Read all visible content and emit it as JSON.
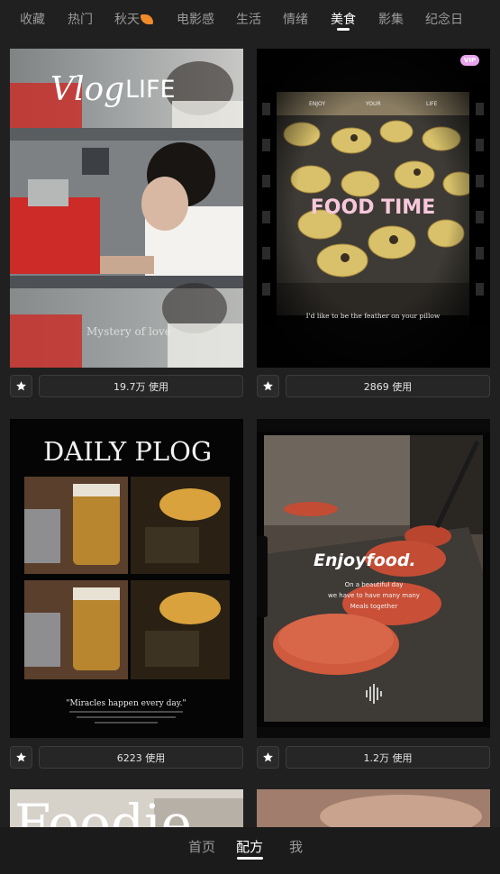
{
  "tabs": [
    {
      "label": "收藏"
    },
    {
      "label": "热门"
    },
    {
      "label": "秋天"
    },
    {
      "label": "电影感"
    },
    {
      "label": "生活"
    },
    {
      "label": "情绪"
    },
    {
      "label": "美食",
      "active": true
    },
    {
      "label": "影集"
    },
    {
      "label": "纪念日"
    }
  ],
  "cards": [
    {
      "usage": "19.7万 使用",
      "overlay": {
        "brand_script": "Vlog",
        "brand": "LIFE",
        "subtitle": "Mystery of love"
      }
    },
    {
      "vip": "VIP",
      "usage": "2869 使用",
      "overlay": {
        "film_labels": [
          "ENJOY",
          "YOUR",
          "LIFE"
        ],
        "title": "FOOD TIME",
        "caption": "I'd like to be the feather on your pillow"
      }
    },
    {
      "usage": "6223 使用",
      "overlay": {
        "title": "DAILY PLOG",
        "quote": "\"Miracles happen every day.\""
      }
    },
    {
      "usage": "1.2万 使用",
      "overlay": {
        "title": "Enjoyfood.",
        "line1": "On a beautiful day",
        "line2": "we have to have many many",
        "line3": "Meals together"
      }
    }
  ],
  "partial_cards": [
    {
      "overlay": "Foodie"
    },
    {}
  ],
  "bottom_nav": [
    {
      "label": "首页"
    },
    {
      "label": "配方",
      "active": true
    },
    {
      "label": "我"
    }
  ],
  "colors": {
    "background": "#202020",
    "tab_inactive": "#9a9a9a",
    "tab_active": "#ffffff",
    "leaf_accent": "#f08a2a",
    "food_time_pink": "#f7c8dc",
    "vip_badge": "#e9a3ee"
  }
}
